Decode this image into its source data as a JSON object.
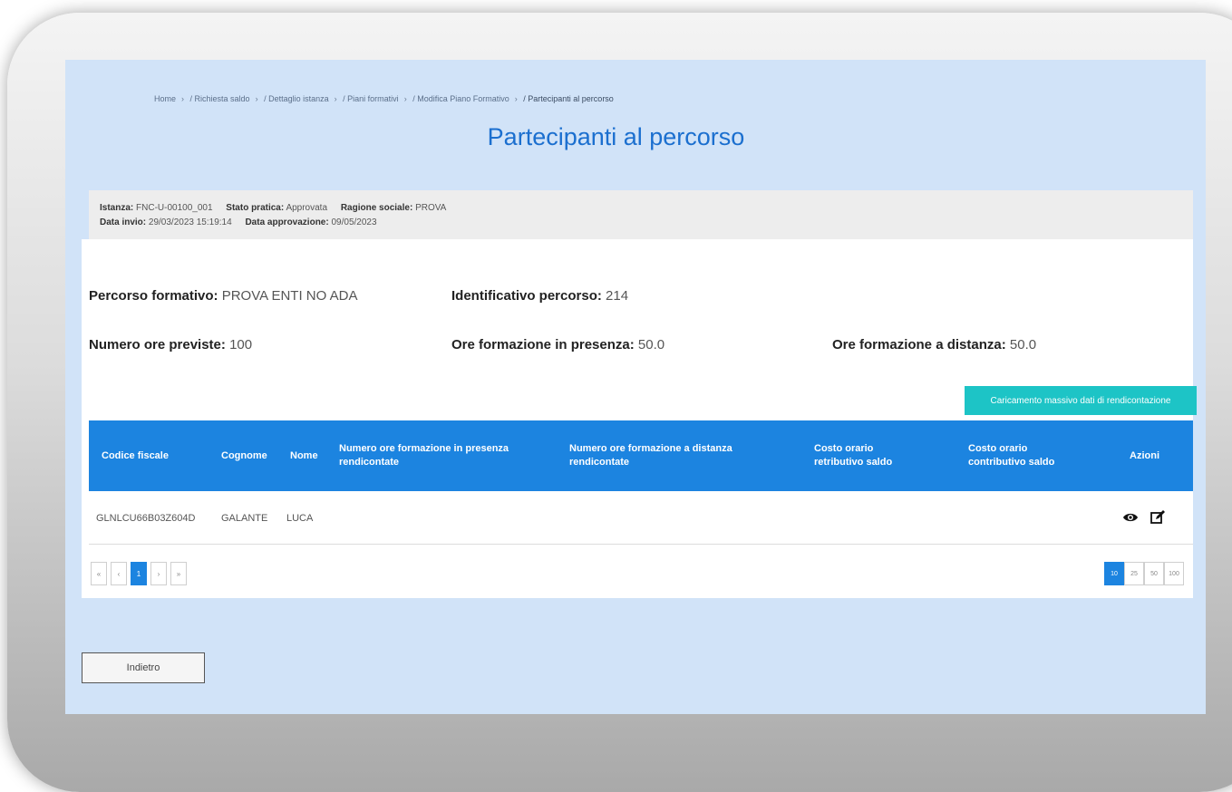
{
  "breadcrumb": {
    "items": [
      "Home",
      "/ Richiesta saldo",
      "/ Dettaglio istanza",
      "/ Piani formativi",
      "/ Modifica Piano Formativo"
    ],
    "current": "/ Partecipanti al percorso",
    "separator": "›"
  },
  "page_title": "Partecipanti al percorso",
  "info": {
    "istanza_label": "Istanza:",
    "istanza_value": "FNC-U-00100_001",
    "stato_label": "Stato pratica:",
    "stato_value": "Approvata",
    "ragione_label": "Ragione sociale:",
    "ragione_value": "PROVA",
    "invio_label": "Data invio:",
    "invio_value": "29/03/2023 15:19:14",
    "approvazione_label": "Data approvazione:",
    "approvazione_value": "09/05/2023"
  },
  "details": {
    "percorso_label": "Percorso formativo:",
    "percorso_value": "PROVA ENTI NO ADA",
    "identificativo_label": "Identificativo percorso:",
    "identificativo_value": "214",
    "ore_previste_label": "Numero ore previste:",
    "ore_previste_value": "100",
    "ore_presenza_label": "Ore formazione in presenza:",
    "ore_presenza_value": "50.0",
    "ore_distanza_label": "Ore formazione a distanza:",
    "ore_distanza_value": "50.0"
  },
  "bulk_upload_label": "Caricamento massivo dati di rendicontazione",
  "table": {
    "headers": [
      "Codice fiscale",
      "Cognome",
      "Nome",
      "Numero ore formazione in presenza rendicontate",
      "Numero ore formazione a distanza rendicontate",
      "Costo orario retributivo saldo",
      "Costo orario contributivo saldo",
      "Azioni"
    ],
    "rows": [
      {
        "codice_fiscale": "GLNLCU66B03Z604D",
        "cognome": "GALANTE",
        "nome": "LUCA",
        "ore_presenza": "",
        "ore_distanza": "",
        "costo_retributivo": "",
        "costo_contributivo": ""
      }
    ]
  },
  "pagination": {
    "first": "«",
    "prev": "‹",
    "current": "1",
    "next": "›",
    "last": "»",
    "page_sizes": [
      "10",
      "25",
      "50",
      "100"
    ],
    "selected_page_size": "10"
  },
  "back_button_label": "Indietro",
  "colors": {
    "page_background": "#d1e3f8",
    "accent_blue": "#1c84e0",
    "title_blue": "#1b6fcf",
    "teal_button": "#1dc4c6"
  },
  "icons": {
    "view": "eye-icon",
    "edit": "edit-icon"
  }
}
